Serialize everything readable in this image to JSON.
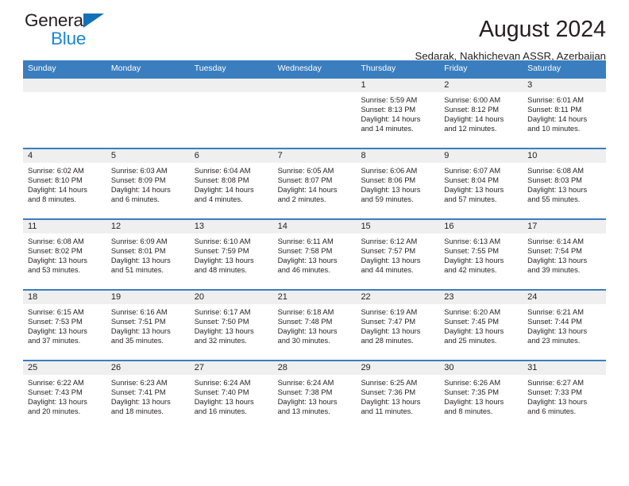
{
  "brand": {
    "name_part1": "General",
    "name_part2": "Blue",
    "accent_color": "#1b86d6",
    "triangle_color": "#1272b8"
  },
  "header": {
    "title": "August 2024",
    "subtitle": "Sedarak, Nakhichevan ASSR, Azerbaijan"
  },
  "calendar": {
    "header_color": "#3a7ebf",
    "weekdays": [
      "Sunday",
      "Monday",
      "Tuesday",
      "Wednesday",
      "Thursday",
      "Friday",
      "Saturday"
    ],
    "weeks": [
      [
        {
          "day": "",
          "sunrise": "",
          "sunset": "",
          "daylight_line1": "",
          "daylight_line2": ""
        },
        {
          "day": "",
          "sunrise": "",
          "sunset": "",
          "daylight_line1": "",
          "daylight_line2": ""
        },
        {
          "day": "",
          "sunrise": "",
          "sunset": "",
          "daylight_line1": "",
          "daylight_line2": ""
        },
        {
          "day": "",
          "sunrise": "",
          "sunset": "",
          "daylight_line1": "",
          "daylight_line2": ""
        },
        {
          "day": "1",
          "sunrise": "Sunrise: 5:59 AM",
          "sunset": "Sunset: 8:13 PM",
          "daylight_line1": "Daylight: 14 hours",
          "daylight_line2": "and 14 minutes."
        },
        {
          "day": "2",
          "sunrise": "Sunrise: 6:00 AM",
          "sunset": "Sunset: 8:12 PM",
          "daylight_line1": "Daylight: 14 hours",
          "daylight_line2": "and 12 minutes."
        },
        {
          "day": "3",
          "sunrise": "Sunrise: 6:01 AM",
          "sunset": "Sunset: 8:11 PM",
          "daylight_line1": "Daylight: 14 hours",
          "daylight_line2": "and 10 minutes."
        }
      ],
      [
        {
          "day": "4",
          "sunrise": "Sunrise: 6:02 AM",
          "sunset": "Sunset: 8:10 PM",
          "daylight_line1": "Daylight: 14 hours",
          "daylight_line2": "and 8 minutes."
        },
        {
          "day": "5",
          "sunrise": "Sunrise: 6:03 AM",
          "sunset": "Sunset: 8:09 PM",
          "daylight_line1": "Daylight: 14 hours",
          "daylight_line2": "and 6 minutes."
        },
        {
          "day": "6",
          "sunrise": "Sunrise: 6:04 AM",
          "sunset": "Sunset: 8:08 PM",
          "daylight_line1": "Daylight: 14 hours",
          "daylight_line2": "and 4 minutes."
        },
        {
          "day": "7",
          "sunrise": "Sunrise: 6:05 AM",
          "sunset": "Sunset: 8:07 PM",
          "daylight_line1": "Daylight: 14 hours",
          "daylight_line2": "and 2 minutes."
        },
        {
          "day": "8",
          "sunrise": "Sunrise: 6:06 AM",
          "sunset": "Sunset: 8:06 PM",
          "daylight_line1": "Daylight: 13 hours",
          "daylight_line2": "and 59 minutes."
        },
        {
          "day": "9",
          "sunrise": "Sunrise: 6:07 AM",
          "sunset": "Sunset: 8:04 PM",
          "daylight_line1": "Daylight: 13 hours",
          "daylight_line2": "and 57 minutes."
        },
        {
          "day": "10",
          "sunrise": "Sunrise: 6:08 AM",
          "sunset": "Sunset: 8:03 PM",
          "daylight_line1": "Daylight: 13 hours",
          "daylight_line2": "and 55 minutes."
        }
      ],
      [
        {
          "day": "11",
          "sunrise": "Sunrise: 6:08 AM",
          "sunset": "Sunset: 8:02 PM",
          "daylight_line1": "Daylight: 13 hours",
          "daylight_line2": "and 53 minutes."
        },
        {
          "day": "12",
          "sunrise": "Sunrise: 6:09 AM",
          "sunset": "Sunset: 8:01 PM",
          "daylight_line1": "Daylight: 13 hours",
          "daylight_line2": "and 51 minutes."
        },
        {
          "day": "13",
          "sunrise": "Sunrise: 6:10 AM",
          "sunset": "Sunset: 7:59 PM",
          "daylight_line1": "Daylight: 13 hours",
          "daylight_line2": "and 48 minutes."
        },
        {
          "day": "14",
          "sunrise": "Sunrise: 6:11 AM",
          "sunset": "Sunset: 7:58 PM",
          "daylight_line1": "Daylight: 13 hours",
          "daylight_line2": "and 46 minutes."
        },
        {
          "day": "15",
          "sunrise": "Sunrise: 6:12 AM",
          "sunset": "Sunset: 7:57 PM",
          "daylight_line1": "Daylight: 13 hours",
          "daylight_line2": "and 44 minutes."
        },
        {
          "day": "16",
          "sunrise": "Sunrise: 6:13 AM",
          "sunset": "Sunset: 7:55 PM",
          "daylight_line1": "Daylight: 13 hours",
          "daylight_line2": "and 42 minutes."
        },
        {
          "day": "17",
          "sunrise": "Sunrise: 6:14 AM",
          "sunset": "Sunset: 7:54 PM",
          "daylight_line1": "Daylight: 13 hours",
          "daylight_line2": "and 39 minutes."
        }
      ],
      [
        {
          "day": "18",
          "sunrise": "Sunrise: 6:15 AM",
          "sunset": "Sunset: 7:53 PM",
          "daylight_line1": "Daylight: 13 hours",
          "daylight_line2": "and 37 minutes."
        },
        {
          "day": "19",
          "sunrise": "Sunrise: 6:16 AM",
          "sunset": "Sunset: 7:51 PM",
          "daylight_line1": "Daylight: 13 hours",
          "daylight_line2": "and 35 minutes."
        },
        {
          "day": "20",
          "sunrise": "Sunrise: 6:17 AM",
          "sunset": "Sunset: 7:50 PM",
          "daylight_line1": "Daylight: 13 hours",
          "daylight_line2": "and 32 minutes."
        },
        {
          "day": "21",
          "sunrise": "Sunrise: 6:18 AM",
          "sunset": "Sunset: 7:48 PM",
          "daylight_line1": "Daylight: 13 hours",
          "daylight_line2": "and 30 minutes."
        },
        {
          "day": "22",
          "sunrise": "Sunrise: 6:19 AM",
          "sunset": "Sunset: 7:47 PM",
          "daylight_line1": "Daylight: 13 hours",
          "daylight_line2": "and 28 minutes."
        },
        {
          "day": "23",
          "sunrise": "Sunrise: 6:20 AM",
          "sunset": "Sunset: 7:45 PM",
          "daylight_line1": "Daylight: 13 hours",
          "daylight_line2": "and 25 minutes."
        },
        {
          "day": "24",
          "sunrise": "Sunrise: 6:21 AM",
          "sunset": "Sunset: 7:44 PM",
          "daylight_line1": "Daylight: 13 hours",
          "daylight_line2": "and 23 minutes."
        }
      ],
      [
        {
          "day": "25",
          "sunrise": "Sunrise: 6:22 AM",
          "sunset": "Sunset: 7:43 PM",
          "daylight_line1": "Daylight: 13 hours",
          "daylight_line2": "and 20 minutes."
        },
        {
          "day": "26",
          "sunrise": "Sunrise: 6:23 AM",
          "sunset": "Sunset: 7:41 PM",
          "daylight_line1": "Daylight: 13 hours",
          "daylight_line2": "and 18 minutes."
        },
        {
          "day": "27",
          "sunrise": "Sunrise: 6:24 AM",
          "sunset": "Sunset: 7:40 PM",
          "daylight_line1": "Daylight: 13 hours",
          "daylight_line2": "and 16 minutes."
        },
        {
          "day": "28",
          "sunrise": "Sunrise: 6:24 AM",
          "sunset": "Sunset: 7:38 PM",
          "daylight_line1": "Daylight: 13 hours",
          "daylight_line2": "and 13 minutes."
        },
        {
          "day": "29",
          "sunrise": "Sunrise: 6:25 AM",
          "sunset": "Sunset: 7:36 PM",
          "daylight_line1": "Daylight: 13 hours",
          "daylight_line2": "and 11 minutes."
        },
        {
          "day": "30",
          "sunrise": "Sunrise: 6:26 AM",
          "sunset": "Sunset: 7:35 PM",
          "daylight_line1": "Daylight: 13 hours",
          "daylight_line2": "and 8 minutes."
        },
        {
          "day": "31",
          "sunrise": "Sunrise: 6:27 AM",
          "sunset": "Sunset: 7:33 PM",
          "daylight_line1": "Daylight: 13 hours",
          "daylight_line2": "and 6 minutes."
        }
      ]
    ]
  }
}
